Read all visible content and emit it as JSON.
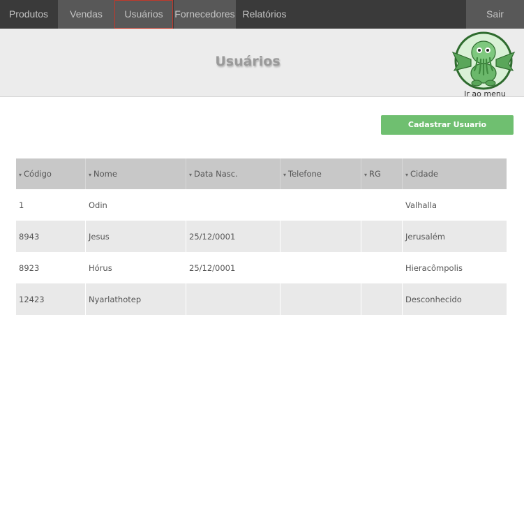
{
  "nav": {
    "items": [
      {
        "label": "Produtos"
      },
      {
        "label": "Vendas"
      },
      {
        "label": "Usuários"
      },
      {
        "label": "Fornecedores"
      },
      {
        "label": "Relatórios"
      }
    ],
    "logout_label": "Sair"
  },
  "header": {
    "title": "Usuários",
    "menu_link_label": "Ir ao menu",
    "menu_icon": "cthulhu-mascot-icon"
  },
  "actions": {
    "create_user_label": "Cadastrar Usuario"
  },
  "table": {
    "sort_icon": "▾",
    "columns": [
      "Código",
      "Nome",
      "Data Nasc.",
      "Telefone",
      "RG",
      "Cidade"
    ],
    "rows": [
      {
        "codigo": "1",
        "nome": "Odin",
        "data_nasc": "",
        "telefone": "",
        "rg": "",
        "cidade": "Valhalla"
      },
      {
        "codigo": "8943",
        "nome": "Jesus",
        "data_nasc": "25/12/0001",
        "telefone": "",
        "rg": "",
        "cidade": "Jerusalém"
      },
      {
        "codigo": "8923",
        "nome": "Hórus",
        "data_nasc": "25/12/0001",
        "telefone": "",
        "rg": "",
        "cidade": "Hieracômpolis"
      },
      {
        "codigo": "12423",
        "nome": "Nyarlathotep",
        "data_nasc": "",
        "telefone": "",
        "rg": "",
        "cidade": "Desconhecido"
      }
    ]
  },
  "colors": {
    "nav_bg": "#3a3a3a",
    "nav_active_bg": "#585858",
    "nav_current_border": "#c0392b",
    "header_bg": "#ececec",
    "primary_button": "#6fbf70",
    "table_header_bg": "#c8c8c8",
    "row_alt_bg": "#e9e9e9"
  }
}
